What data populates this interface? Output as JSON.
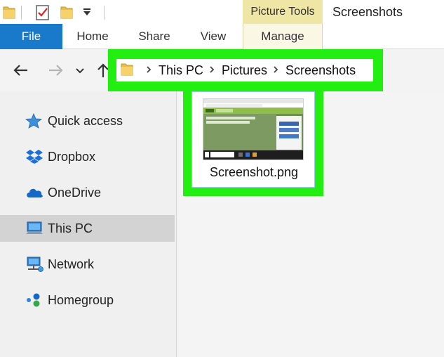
{
  "window": {
    "title": "Screenshots",
    "contextual_group": "Picture Tools",
    "quick_access_icons": [
      "folder-icon",
      "properties-check-icon",
      "new-folder-icon",
      "customize-dropdown-icon"
    ]
  },
  "ribbon": {
    "tabs": [
      {
        "label": "File"
      },
      {
        "label": "Home"
      },
      {
        "label": "Share"
      },
      {
        "label": "View"
      },
      {
        "label": "Manage"
      }
    ]
  },
  "address_bar": {
    "breadcrumbs": [
      "This PC",
      "Pictures",
      "Screenshots"
    ],
    "nav_icons": [
      "back-arrow-icon",
      "forward-arrow-icon",
      "recent-locations-icon",
      "up-arrow-icon"
    ]
  },
  "sidebar": {
    "items": [
      {
        "label": "Quick access",
        "icon": "star-icon",
        "selected": false
      },
      {
        "label": "Dropbox",
        "icon": "dropbox-icon",
        "selected": false
      },
      {
        "label": "OneDrive",
        "icon": "cloud-icon",
        "selected": false
      },
      {
        "label": "This PC",
        "icon": "computer-icon",
        "selected": true
      },
      {
        "label": "Network",
        "icon": "network-icon",
        "selected": false
      },
      {
        "label": "Homegroup",
        "icon": "homegroup-icon",
        "selected": false
      }
    ]
  },
  "files": [
    {
      "name": "Screenshot.png",
      "selected": true
    }
  ],
  "colors": {
    "file_tab": "#1979ca",
    "picture_tools": "#efe6a6",
    "highlight": "#22ee11",
    "selected_nav": "#d3d3d3"
  }
}
